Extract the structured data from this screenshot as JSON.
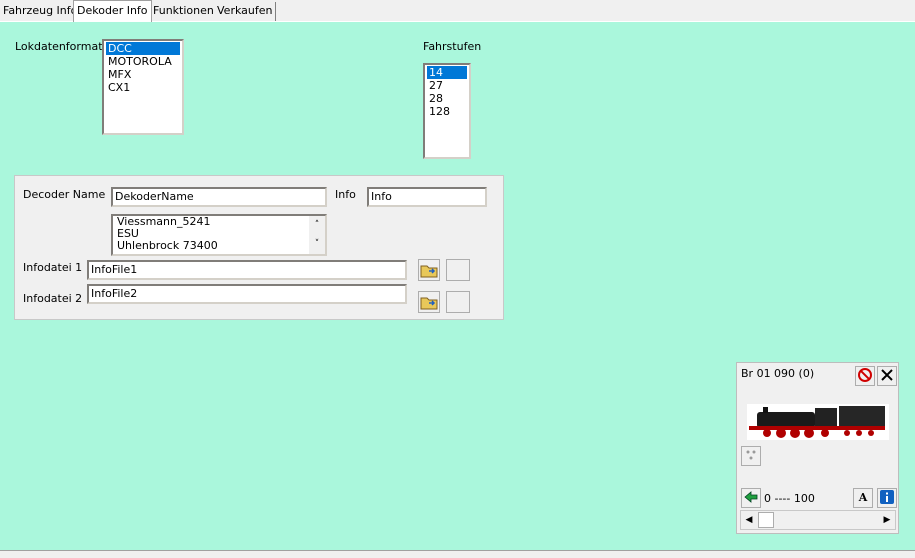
{
  "tabs": [
    {
      "label": "Fahrzeug Info",
      "active": false
    },
    {
      "label": "Dekoder Info",
      "active": true
    },
    {
      "label": "Funktionen",
      "active": false
    },
    {
      "label": "Verkaufen",
      "active": false
    }
  ],
  "lokdatenformat": {
    "label": "Lokdatenformat",
    "options": [
      "DCC",
      "MOTOROLA",
      "MFX",
      "CX1"
    ],
    "selected": "DCC"
  },
  "fahrstufen": {
    "label": "Fahrstufen",
    "options": [
      "14",
      "27",
      "28",
      "128"
    ],
    "selected": "14"
  },
  "decoder": {
    "name_label": "Decoder Name",
    "name_value": "DekoderName",
    "info_label": "Info",
    "info_value": "Info",
    "list_items": [
      "Viessmann_5241",
      "ESU",
      "Uhlenbrock 73400"
    ],
    "infodatei1_label": "Infodatei 1",
    "infodatei1_value": "InfoFile1",
    "infodatei2_label": "Infodatei 2",
    "infodatei2_value": "InfoFile2"
  },
  "loco_panel": {
    "name": "Br 01 090 (0)",
    "speed_range": "0 ---- 100"
  },
  "colors": {
    "background": "#aaf7dc",
    "selection": "#0078d7"
  }
}
